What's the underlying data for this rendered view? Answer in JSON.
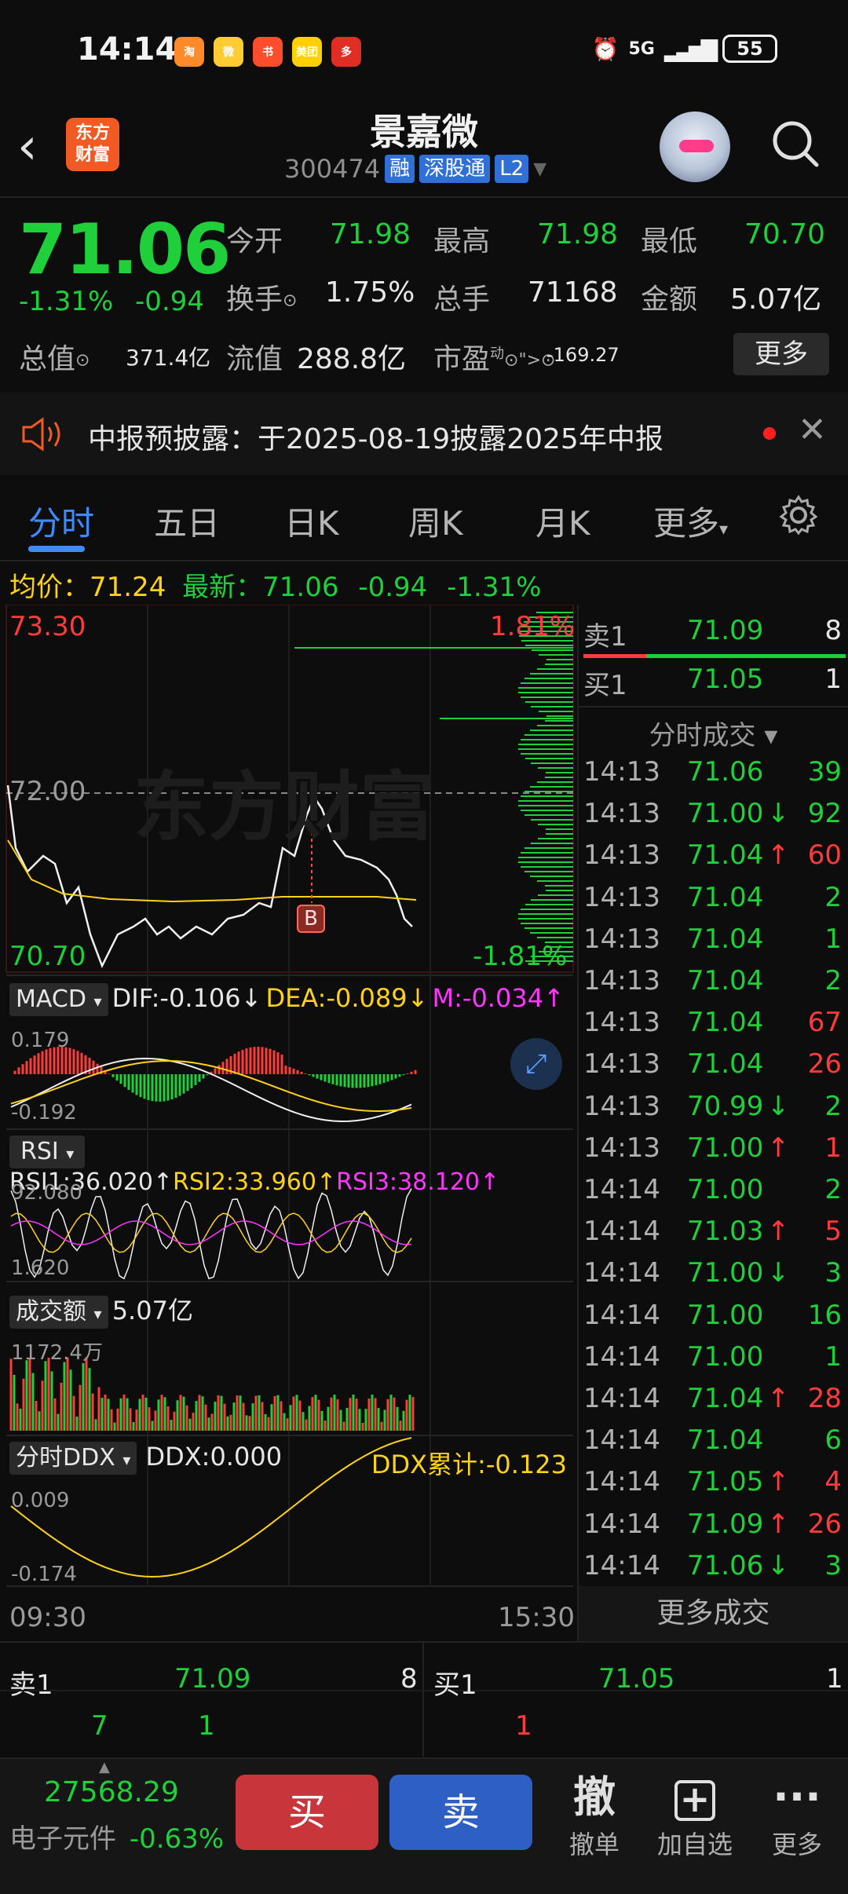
{
  "status": {
    "time": "14:14",
    "network": "5G",
    "battery": "55",
    "apps": [
      {
        "name": "taobao-icon",
        "color": "#ff8a2a",
        "glyph": "淘"
      },
      {
        "name": "weibo-icon",
        "color": "#ffcc33",
        "glyph": "微"
      },
      {
        "name": "xiaohongshu-icon",
        "color": "#ff4d2e",
        "glyph": "书"
      },
      {
        "name": "meituan-icon",
        "color": "#ffd000",
        "glyph": "美团"
      },
      {
        "name": "pinduoduo-icon",
        "color": "#e02e24",
        "glyph": "多"
      }
    ]
  },
  "header": {
    "logo": "东方\n财富",
    "name": "景嘉微",
    "code": "300474",
    "tags": [
      "融",
      "深股通",
      "L2"
    ]
  },
  "quote": {
    "price": "71.06",
    "pct": "-1.31%",
    "chg": "-0.94",
    "open_label": "今开",
    "open": "71.98",
    "high_label": "最高",
    "high": "71.98",
    "low_label": "最低",
    "low": "70.70",
    "turnover_label": "换手",
    "turnover": "1.75%",
    "volume_label": "总手",
    "volume": "71168",
    "amount_label": "金额",
    "amount": "5.07亿",
    "mcap_label": "总值",
    "mcap": "371.4亿",
    "float_label": "流值",
    "float": "288.8亿",
    "pe_label": "市盈",
    "pe_sup": "动",
    "pe": "-169.27",
    "more": "更多"
  },
  "notice": {
    "text": "中报预披露：于2025-08-19披露2025年中报"
  },
  "tabs": [
    "分时",
    "五日",
    "日K",
    "周K",
    "月K",
    "更多"
  ],
  "avg": {
    "avg_label": "均价：",
    "avg": "71.24",
    "latest_label": "最新：",
    "latest": "71.06",
    "chg": "-0.94",
    "pct": "-1.31%"
  },
  "chart": {
    "y_top": "73.30",
    "y_mid": "72.00",
    "y_bottom": "70.70",
    "pct_top": "1.81%",
    "pct_bottom": "-1.81%",
    "watermark": "东方财富",
    "marker": "B",
    "macd": {
      "label": "MACD",
      "dif": "DIF:-0.106↓",
      "dea": "DEA:-0.089↓",
      "m": "M:-0.034↑",
      "top": "0.179",
      "bottom": "-0.192"
    },
    "rsi": {
      "label": "RSI",
      "rsi1": "RSI1:36.020↑",
      "rsi2": "RSI2:33.960↑",
      "rsi3": "RSI3:38.120↑",
      "top": "92.080",
      "bottom": "1.620"
    },
    "amount": {
      "label": "成交额",
      "value": "5.07亿",
      "top": "1172.4万"
    },
    "ddx": {
      "label": "分时DDX",
      "ddx": "DDX:0.000",
      "cum": "DDX累计:-0.123",
      "top": "0.009",
      "bottom": "-0.174"
    },
    "time_start": "09:30",
    "time_end": "15:30"
  },
  "book_right": {
    "sell_label": "卖1",
    "sell_price": "71.09",
    "sell_qty": "8",
    "buy_label": "买1",
    "buy_price": "71.05",
    "buy_qty": "1",
    "ticks_label": "分时成交 ▾",
    "more_label": "更多成交"
  },
  "trades": [
    {
      "t": "14:13",
      "p": "71.06",
      "a": "",
      "v": "39",
      "c": "green"
    },
    {
      "t": "14:13",
      "p": "71.00",
      "a": "↓",
      "v": "92",
      "c": "green"
    },
    {
      "t": "14:13",
      "p": "71.04",
      "a": "↑",
      "v": "60",
      "c": "red"
    },
    {
      "t": "14:13",
      "p": "71.04",
      "a": "",
      "v": "2",
      "c": "green"
    },
    {
      "t": "14:13",
      "p": "71.04",
      "a": "",
      "v": "1",
      "c": "green"
    },
    {
      "t": "14:13",
      "p": "71.04",
      "a": "",
      "v": "2",
      "c": "green"
    },
    {
      "t": "14:13",
      "p": "71.04",
      "a": "",
      "v": "67",
      "c": "red"
    },
    {
      "t": "14:13",
      "p": "71.04",
      "a": "",
      "v": "26",
      "c": "red"
    },
    {
      "t": "14:13",
      "p": "70.99",
      "a": "↓",
      "v": "2",
      "c": "green"
    },
    {
      "t": "14:13",
      "p": "71.00",
      "a": "↑",
      "v": "1",
      "c": "red"
    },
    {
      "t": "14:14",
      "p": "71.00",
      "a": "",
      "v": "2",
      "c": "green"
    },
    {
      "t": "14:14",
      "p": "71.03",
      "a": "↑",
      "v": "5",
      "c": "red"
    },
    {
      "t": "14:14",
      "p": "71.00",
      "a": "↓",
      "v": "3",
      "c": "green"
    },
    {
      "t": "14:14",
      "p": "71.00",
      "a": "",
      "v": "16",
      "c": "green"
    },
    {
      "t": "14:14",
      "p": "71.00",
      "a": "",
      "v": "1",
      "c": "green"
    },
    {
      "t": "14:14",
      "p": "71.04",
      "a": "↑",
      "v": "28",
      "c": "red"
    },
    {
      "t": "14:14",
      "p": "71.04",
      "a": "",
      "v": "6",
      "c": "green"
    },
    {
      "t": "14:14",
      "p": "71.05",
      "a": "↑",
      "v": "4",
      "c": "red"
    },
    {
      "t": "14:14",
      "p": "71.09",
      "a": "↑",
      "v": "26",
      "c": "red"
    },
    {
      "t": "14:14",
      "p": "71.06",
      "a": "↓",
      "v": "3",
      "c": "green"
    }
  ],
  "book": {
    "sell_label": "卖1",
    "sell_price": "71.09",
    "sell_qty": "8",
    "sell_sub1": "7",
    "sell_sub2": "1",
    "buy_label": "买1",
    "buy_price": "71.05",
    "buy_qty": "1",
    "buy_sub1": "1"
  },
  "bottom": {
    "index": "27568.29",
    "sector": "电子元件",
    "sector_pct": "-0.63%",
    "buy": "买",
    "sell": "卖",
    "cancel_icon": "撤",
    "cancel": "撤单",
    "watch": "加自选",
    "more": "更多"
  },
  "colors": {
    "up": "#ff3b3b",
    "down": "#1fd03a",
    "accent": "#3d8bff",
    "buy_btn": "#c8353a",
    "sell_btn": "#2d5fc4"
  }
}
